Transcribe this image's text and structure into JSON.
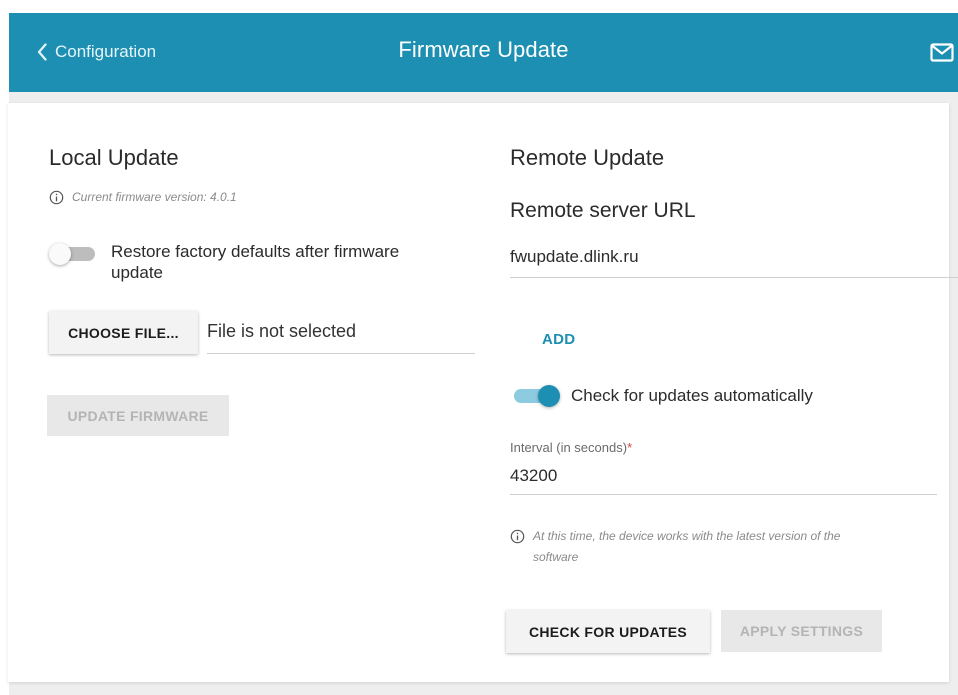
{
  "header": {
    "back_label": "Configuration",
    "title": "Firmware Update"
  },
  "local": {
    "title": "Local Update",
    "version_note": "Current firmware version: 4.0.1",
    "restore_label_line1": "Restore factory defaults after firmware",
    "restore_label_line2": "update",
    "restore_enabled": false,
    "choose_file_label": "CHOOSE FILE...",
    "file_status": "File is not selected",
    "update_button": "UPDATE FIRMWARE"
  },
  "remote": {
    "title": "Remote Update",
    "server_url_title": "Remote server URL",
    "server_url": "fwupdate.dlink.ru",
    "add_label": "ADD",
    "auto_check_label": "Check for updates automatically",
    "auto_check_enabled": true,
    "interval_label": "Interval (in seconds)",
    "interval_required_mark": "*",
    "interval_value": "43200",
    "status_note_line1": "At this time, the device works with the latest version of the",
    "status_note_line2": "software",
    "check_button": "CHECK FOR UPDATES",
    "apply_button": "APPLY SETTINGS"
  },
  "icons": {
    "back": "chevron-left-icon",
    "mail": "mail-icon",
    "info": "info-icon"
  },
  "colors": {
    "accent": "#1d8fb2",
    "toggle_track_on": "#8ccbe0",
    "disabled_text": "#b4b4b4"
  }
}
